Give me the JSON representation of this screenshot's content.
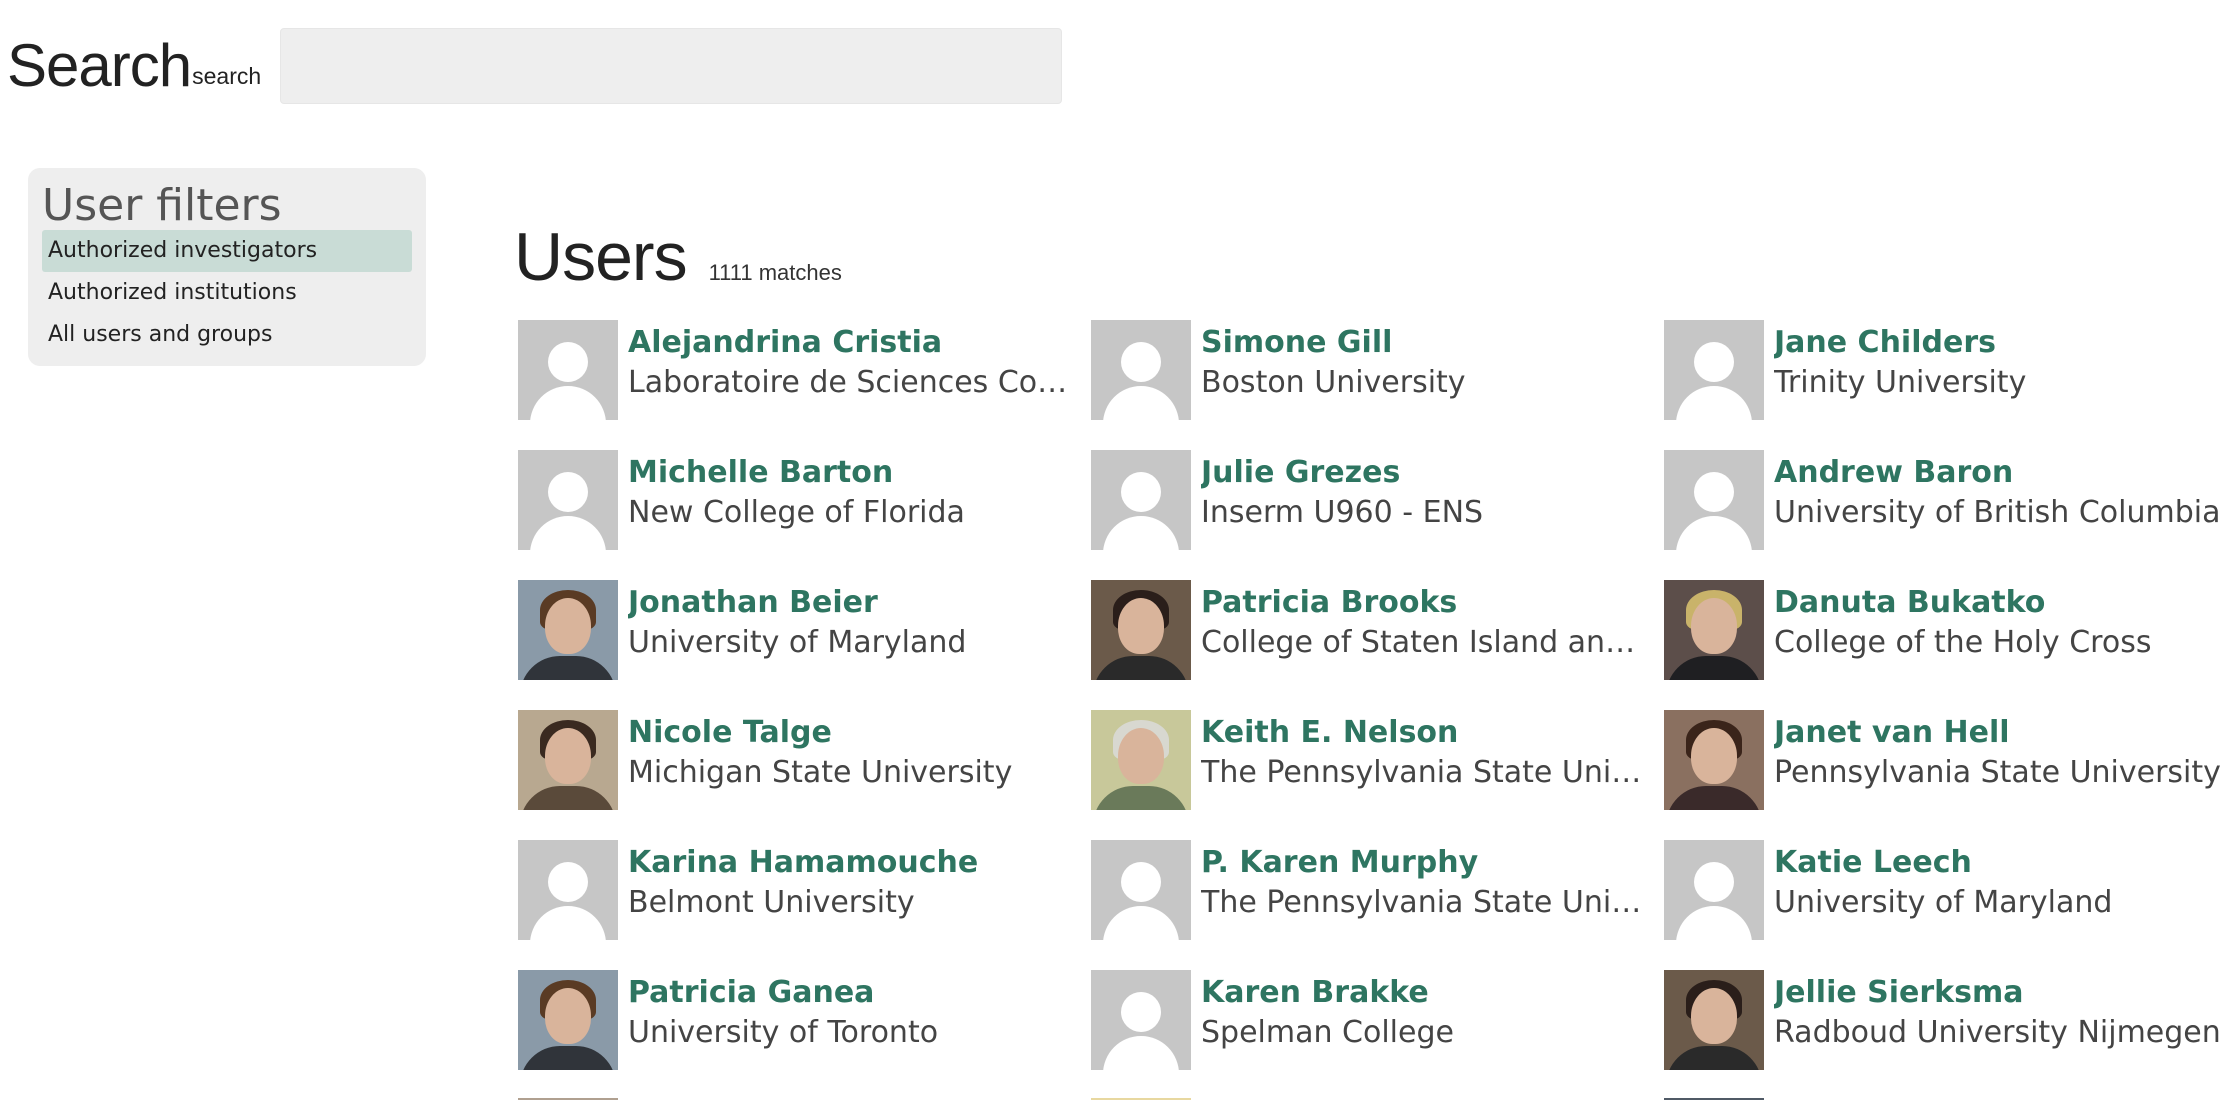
{
  "search": {
    "title": "Search",
    "subtitle": "search",
    "value": "",
    "placeholder": ""
  },
  "filters": {
    "title": "User filters",
    "items": [
      {
        "label": "Authorized investigators",
        "active": true
      },
      {
        "label": "Authorized institutions",
        "active": false
      },
      {
        "label": "All users and groups",
        "active": false
      }
    ]
  },
  "users": {
    "title": "Users",
    "count": "1111 matches",
    "list": [
      {
        "name": "Alejandrina Cristia",
        "institution": "Laboratoire de Sciences Co…",
        "avatar": "placeholder"
      },
      {
        "name": "Simone Gill",
        "institution": "Boston University",
        "avatar": "placeholder"
      },
      {
        "name": "Jane Childers",
        "institution": "Trinity University",
        "avatar": "placeholder"
      },
      {
        "name": "Michelle Barton",
        "institution": "New College of Florida",
        "avatar": "placeholder"
      },
      {
        "name": "Julie Grezes",
        "institution": "Inserm U960 - ENS",
        "avatar": "placeholder"
      },
      {
        "name": "Andrew Baron",
        "institution": "University of British Columbia",
        "avatar": "placeholder"
      },
      {
        "name": "Jonathan Beier",
        "institution": "University of Maryland",
        "avatar": "photo"
      },
      {
        "name": "Patricia Brooks",
        "institution": "College of Staten Island an…",
        "avatar": "photo"
      },
      {
        "name": "Danuta Bukatko",
        "institution": "College of the Holy Cross",
        "avatar": "photo"
      },
      {
        "name": "Nicole Talge",
        "institution": "Michigan State University",
        "avatar": "photo"
      },
      {
        "name": "Keith E. Nelson",
        "institution": "The Pennsylvania State Univ…",
        "avatar": "photo"
      },
      {
        "name": "Janet van Hell",
        "institution": "Pennsylvania State University",
        "avatar": "photo"
      },
      {
        "name": "Karina Hamamouche",
        "institution": "Belmont University",
        "avatar": "placeholder"
      },
      {
        "name": "P. Karen Murphy",
        "institution": "The Pennsylvania State Univ…",
        "avatar": "placeholder"
      },
      {
        "name": "Katie Leech",
        "institution": "University of Maryland",
        "avatar": "placeholder"
      },
      {
        "name": "Patricia Ganea",
        "institution": "University of Toronto",
        "avatar": "photo"
      },
      {
        "name": "Karen Brakke",
        "institution": "Spelman College",
        "avatar": "placeholder"
      },
      {
        "name": "Jellie Sierksma",
        "institution": "Radboud University Nijmegen",
        "avatar": "photo"
      }
    ]
  }
}
